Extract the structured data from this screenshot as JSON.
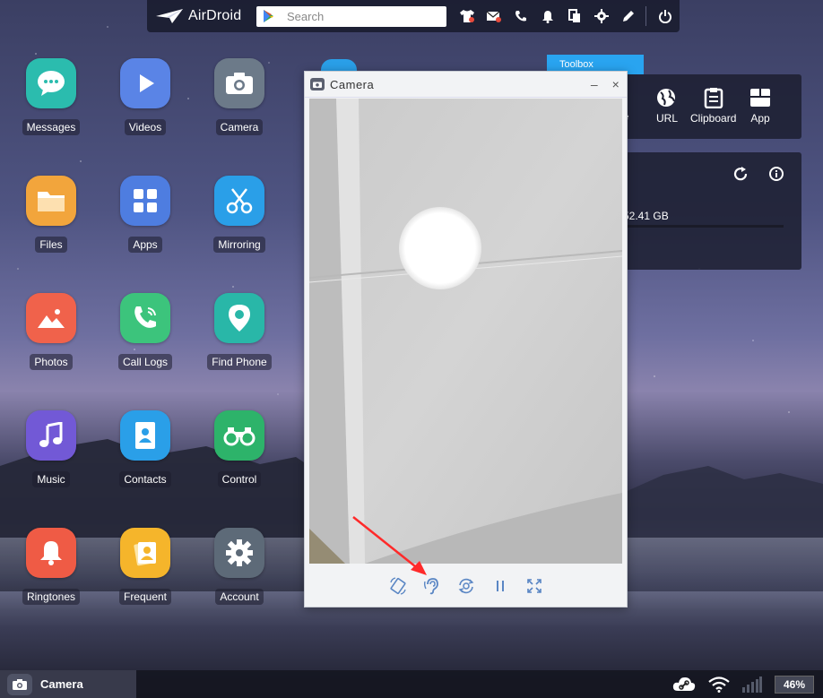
{
  "topbar": {
    "logo_text": "AirDroid",
    "search_placeholder": "Search",
    "icons": [
      "tshirt-icon",
      "sms-icon",
      "phone-icon",
      "bell-icon",
      "copy-icon",
      "gear-icon",
      "edit-icon",
      "power-icon"
    ]
  },
  "apps": [
    {
      "label": "Messages",
      "color": "#2bbcae"
    },
    {
      "label": "Videos",
      "color": "#5a84e6"
    },
    {
      "label": "Camera",
      "color": "#6c7a89"
    },
    {
      "label": "Files",
      "color": "#f2a53c"
    },
    {
      "label": "Apps",
      "color": "#4e7de0"
    },
    {
      "label": "Mirroring",
      "color": "#2a9fe8"
    },
    {
      "label": "Photos",
      "color": "#f0624b"
    },
    {
      "label": "Call Logs",
      "color": "#3cc47c"
    },
    {
      "label": "Find Phone",
      "color": "#29b7a8"
    },
    {
      "label": "Music",
      "color": "#7259d6"
    },
    {
      "label": "Contacts",
      "color": "#2a9fe8"
    },
    {
      "label": "Control",
      "color": "#2db36a"
    },
    {
      "label": "Ringtones",
      "color": "#ef5b45"
    },
    {
      "label": "Frequent",
      "color": "#f5b52b"
    },
    {
      "label": "Account",
      "color": "#5d6a78"
    }
  ],
  "toolbox": {
    "tab_label": "Toolbox",
    "tools": [
      {
        "label": "e",
        "icon": "file-icon"
      },
      {
        "label": "URL",
        "icon": "globe-icon"
      },
      {
        "label": "Clipboard",
        "icon": "clipboard-icon"
      },
      {
        "label": "App",
        "icon": "app-icon"
      }
    ]
  },
  "storage": {
    "text": "52.41 GB"
  },
  "camera_window": {
    "title": "Camera",
    "minimize": "–",
    "close": "×",
    "controls": [
      "rotate-icon",
      "ear-icon",
      "switch-camera-icon",
      "pause-icon",
      "fullscreen-icon"
    ]
  },
  "taskbar": {
    "app_label": "Camera",
    "battery": "46%"
  }
}
